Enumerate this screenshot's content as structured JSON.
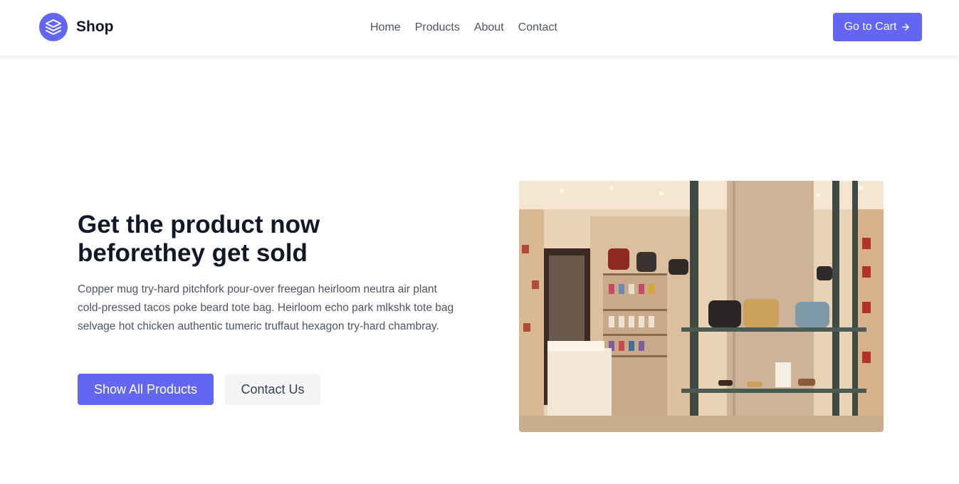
{
  "header": {
    "brand_name": "Shop",
    "nav": [
      "Home",
      "Products",
      "About",
      "Contact"
    ],
    "cart_button": "Go to Cart"
  },
  "hero": {
    "title_line1": "Get the product now",
    "title_line2": "beforethey get sold",
    "description": "Copper mug try-hard pitchfork pour-over freegan heirloom neutra air plant cold-pressed tacos poke beard tote bag. Heirloom echo park mlkshk tote bag selvage hot chicken authentic tumeric truffaut hexagon try-hard chambray.",
    "primary_button": "Show All Products",
    "secondary_button": "Contact Us"
  },
  "colors": {
    "accent": "#6366f1",
    "heading": "#111827",
    "body_text": "#4b5563",
    "secondary_button_bg": "#f3f4f6"
  },
  "icons": {
    "logo": "layers-icon",
    "cart_arrow": "arrow-right-icon"
  }
}
